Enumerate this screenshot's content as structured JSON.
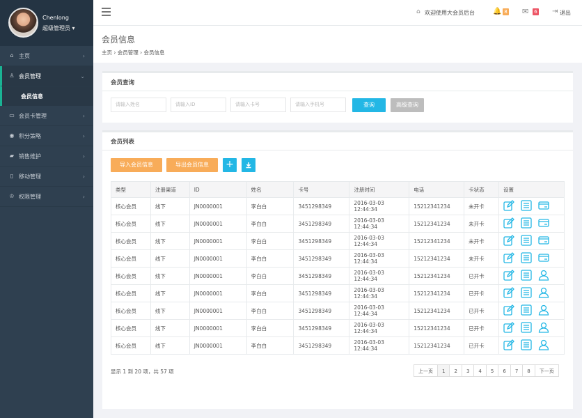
{
  "sidebar": {
    "user_name": "Chenlong",
    "user_role": "超级管理员 ▾",
    "items": [
      {
        "label": "主页",
        "icon": "home-icon"
      },
      {
        "label": "会员管理",
        "icon": "users-icon",
        "active": true
      },
      {
        "label": "会员卡管理",
        "icon": "card-icon"
      },
      {
        "label": "积分策略",
        "icon": "points-icon"
      },
      {
        "label": "销售维护",
        "icon": "sales-icon"
      },
      {
        "label": "移动管理",
        "icon": "mobile-icon"
      },
      {
        "label": "权限管理",
        "icon": "permission-icon"
      }
    ],
    "sub_item": "会员信息"
  },
  "topbar": {
    "welcome": "欢迎使用大会员后台",
    "bell_count": "8",
    "mail_count": "6",
    "logout": "退出"
  },
  "header": {
    "title": "会员信息",
    "breadcrumb": "主页 ›  会员管理 ›  会员信息"
  },
  "search": {
    "title": "会员查询",
    "name_placeholder": "请输入姓名",
    "id_placeholder": "请输入ID",
    "card_placeholder": "请输入卡号",
    "phone_placeholder": "请输入手机号",
    "query": "查询",
    "advanced": "高级查询"
  },
  "list": {
    "title": "会员列表",
    "import": "导入会员信息",
    "export": "导出会员信息",
    "headers": [
      "类型",
      "注册渠道",
      "ID",
      "姓名",
      "卡号",
      "注册时间",
      "电话",
      "卡状态",
      "设置"
    ],
    "rows": [
      [
        "核心会员",
        "线下",
        "JN0000001",
        "李白白",
        "3451298349",
        "2016-03-03 12:44:34",
        "15212341234",
        "未开卡",
        "card"
      ],
      [
        "核心会员",
        "线下",
        "JN0000001",
        "李白白",
        "3451298349",
        "2016-03-03 12:44:34",
        "15212341234",
        "未开卡",
        "card"
      ],
      [
        "核心会员",
        "线下",
        "JN0000001",
        "李白白",
        "3451298349",
        "2016-03-03 12:44:34",
        "15212341234",
        "未开卡",
        "card"
      ],
      [
        "核心会员",
        "线下",
        "JN0000001",
        "李白白",
        "3451298349",
        "2016-03-03 12:44:34",
        "15212341234",
        "未开卡",
        "card"
      ],
      [
        "核心会员",
        "线下",
        "JN0000001",
        "李白白",
        "3451298349",
        "2016-03-03 12:44:34",
        "15212341234",
        "已开卡",
        "user"
      ],
      [
        "核心会员",
        "线下",
        "JN0000001",
        "李白白",
        "3451298349",
        "2016-03-03 12:44:34",
        "15212341234",
        "已开卡",
        "user"
      ],
      [
        "核心会员",
        "线下",
        "JN0000001",
        "李白白",
        "3451298349",
        "2016-03-03 12:44:34",
        "15212341234",
        "已开卡",
        "user"
      ],
      [
        "核心会员",
        "线下",
        "JN0000001",
        "李白白",
        "3451298349",
        "2016-03-03 12:44:34",
        "15212341234",
        "已开卡",
        "user"
      ],
      [
        "核心会员",
        "线下",
        "JN0000001",
        "李白白",
        "3451298349",
        "2016-03-03 12:44:34",
        "15212341234",
        "已开卡",
        "user"
      ]
    ],
    "info": "显示 1 到 20 项，共 57 项",
    "pager": [
      "上一页",
      "1",
      "2",
      "3",
      "4",
      "5",
      "6",
      "7",
      "8",
      "下一页"
    ]
  },
  "colors": {
    "accent": "#23b7e5",
    "orange": "#f8ac59",
    "sidebar": "#2f4050"
  }
}
